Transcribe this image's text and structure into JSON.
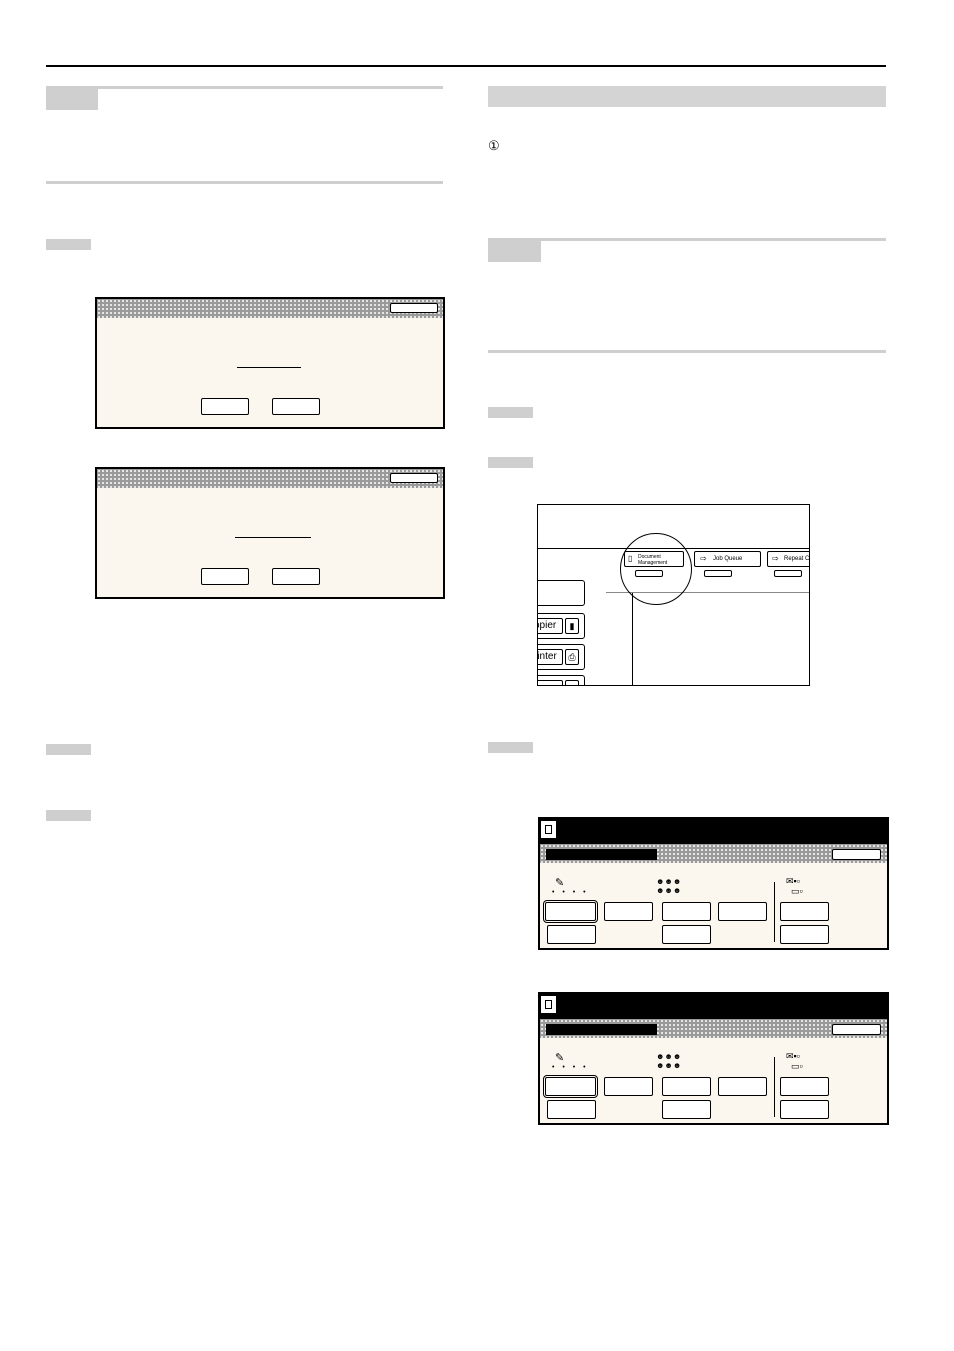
{
  "circle_number": "①",
  "screen": {
    "tab_document_management_line1": "Document",
    "tab_document_management_line2": "Management",
    "tab_job_queue": "Job Queue",
    "tab_repeat_copy": "Repeat Co",
    "side_copier": "opier",
    "side_printer": "rinter"
  }
}
